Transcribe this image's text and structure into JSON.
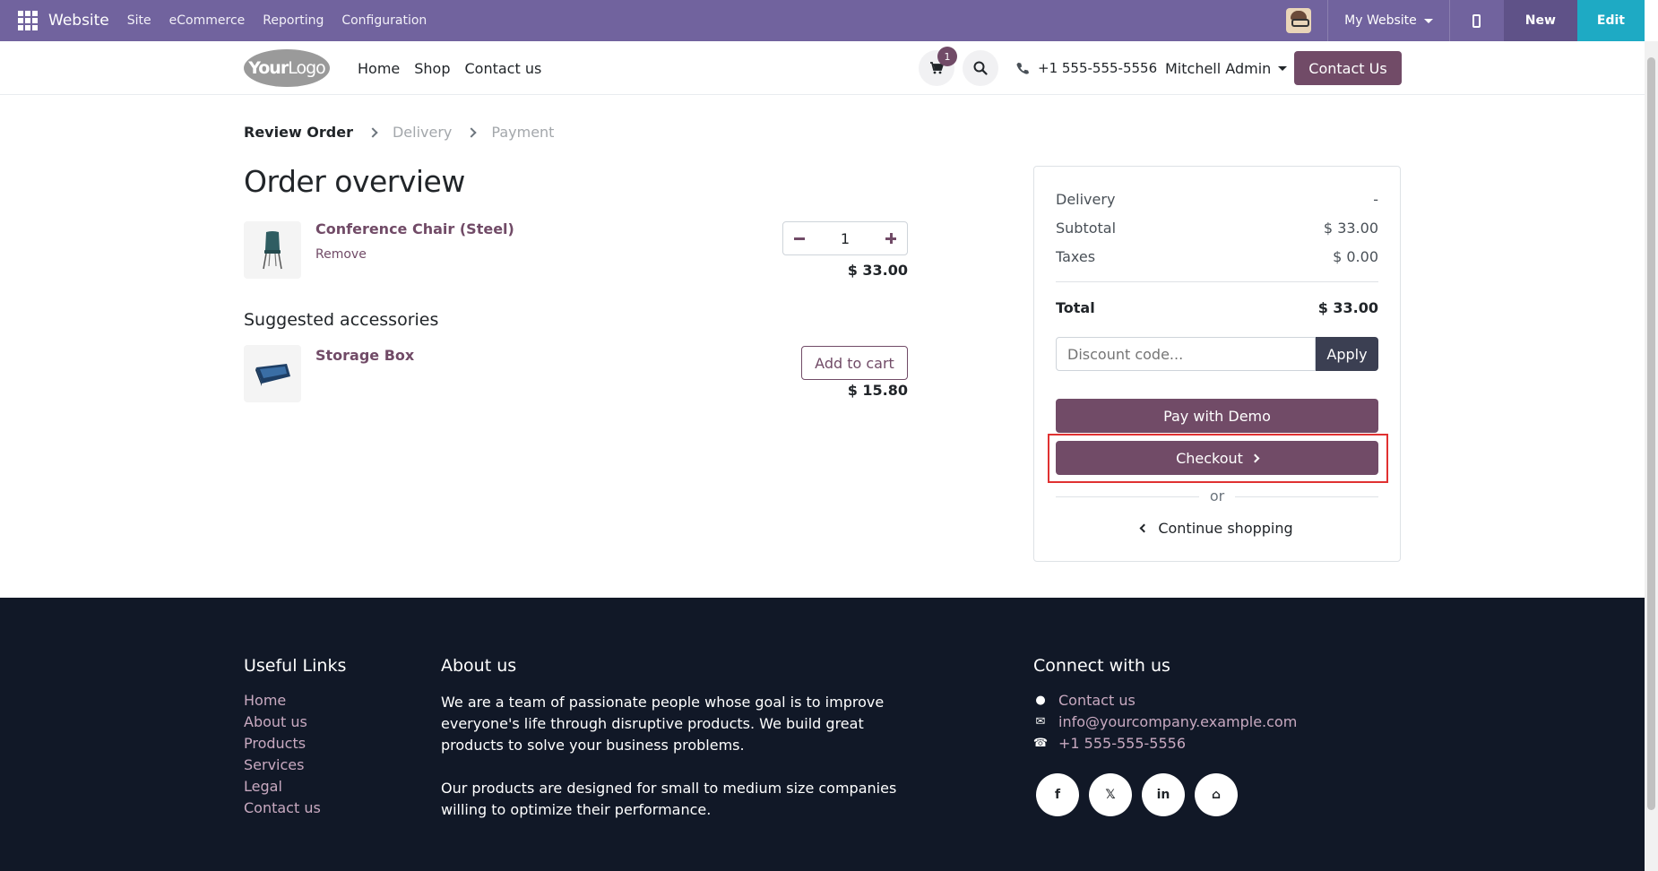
{
  "admin_bar": {
    "brand": "Website",
    "menus": [
      "Site",
      "eCommerce",
      "Reporting",
      "Configuration"
    ],
    "website_selector": "My Website",
    "new_label": "New",
    "edit_label": "Edit",
    "color": "#71639e"
  },
  "header": {
    "logo_text_bold": "Your",
    "logo_text": "Logo",
    "nav": [
      "Home",
      "Shop",
      "Contact us"
    ],
    "cart_count": "1",
    "phone": "+1 555-555-5556",
    "user": "Mitchell Admin",
    "contact_button": "Contact Us"
  },
  "breadcrumb": {
    "steps": [
      "Review Order",
      "Delivery",
      "Payment"
    ],
    "active_index": 0
  },
  "order": {
    "title": "Order overview",
    "lines": [
      {
        "name": "Conference Chair (Steel)",
        "remove_label": "Remove",
        "quantity": "1",
        "price": "$ 33.00"
      }
    ],
    "suggested_title": "Suggested accessories",
    "suggested": [
      {
        "name": "Storage Box",
        "add_label": "Add to cart",
        "price": "$ 15.80"
      }
    ]
  },
  "summary": {
    "delivery_label": "Delivery",
    "delivery_value": "-",
    "subtotal_label": "Subtotal",
    "subtotal_value": "$ 33.00",
    "taxes_label": "Taxes",
    "taxes_value": "$ 0.00",
    "total_label": "Total",
    "total_value": "$ 33.00",
    "discount_placeholder": "Discount code...",
    "apply_label": "Apply",
    "pay_label": "Pay with Demo",
    "checkout_label": "Checkout",
    "or_label": "or",
    "continue_label": "Continue shopping",
    "accent": "#714b67"
  },
  "footer": {
    "useful_links_title": "Useful Links",
    "useful_links": [
      "Home",
      "About us",
      "Products",
      "Services",
      "Legal",
      "Contact us"
    ],
    "about_title": "About us",
    "about_p1": "We are a team of passionate people whose goal is to improve everyone's life through disruptive products. We build great products to solve your business problems.",
    "about_p2": "Our products are designed for small to medium size companies willing to optimize their performance.",
    "connect_title": "Connect with us",
    "contact_link": "Contact us",
    "email": "info@yourcompany.example.com",
    "phone": "+1 555-555-5556",
    "social_icons": [
      "facebook-icon",
      "x-icon",
      "linkedin-icon",
      "home-icon"
    ]
  }
}
